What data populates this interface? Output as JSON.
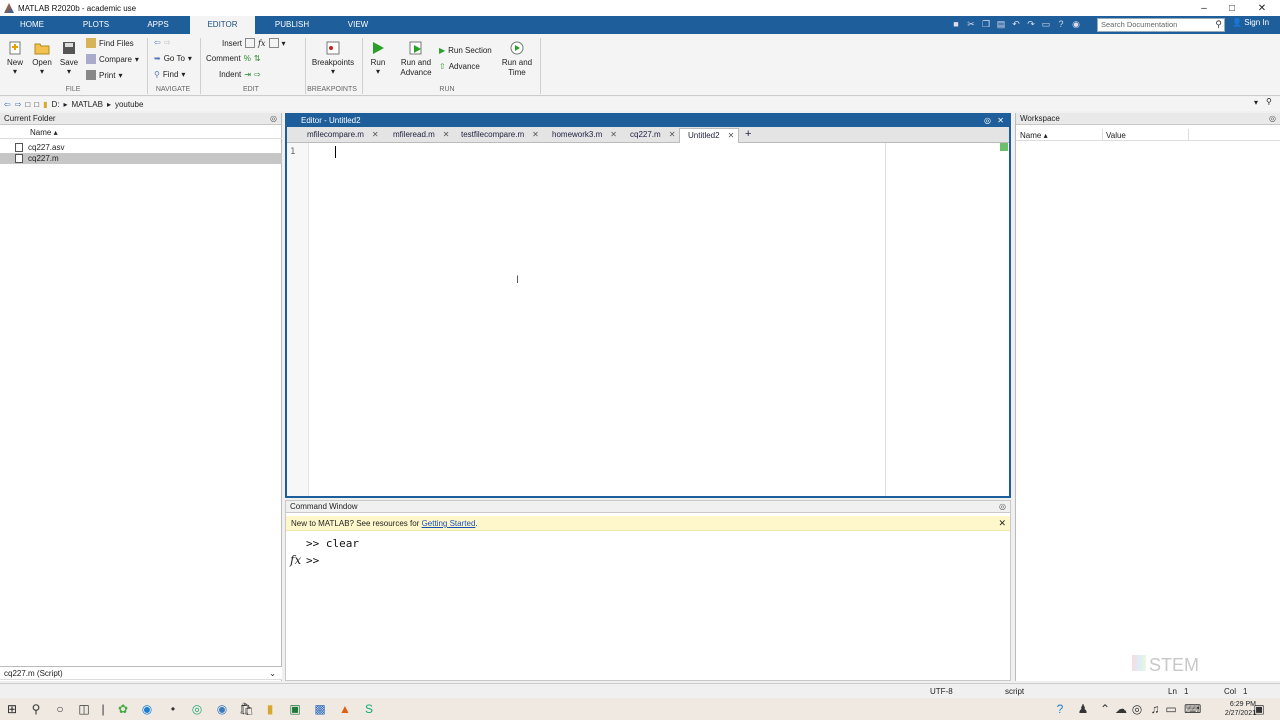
{
  "window": {
    "title": "MATLAB R2020b - academic use"
  },
  "ribbon_tabs": [
    "HOME",
    "PLOTS",
    "APPS",
    "EDITOR",
    "PUBLISH",
    "VIEW"
  ],
  "search": {
    "placeholder": "Search Documentation"
  },
  "signin": "Sign In",
  "toolbar": {
    "new": "New",
    "open": "Open",
    "save": "Save",
    "find_files": "Find Files",
    "compare": "Compare",
    "print": "Print",
    "go_to": "Go To",
    "find": "Find",
    "insert": "Insert",
    "comment": "Comment",
    "indent": "Indent",
    "breakpoints": "Breakpoints",
    "run": "Run",
    "run_and_advance_1": "Run and",
    "run_and_advance_2": "Advance",
    "run_section": "Run Section",
    "advance": "Advance",
    "run_and_time_1": "Run and",
    "run_and_time_2": "Time",
    "groups": {
      "file": "FILE",
      "navigate": "NAVIGATE",
      "edit": "EDIT",
      "breakpoints": "BREAKPOINTS",
      "run": "RUN"
    }
  },
  "address": {
    "drive": "D:",
    "folder1": "MATLAB",
    "folder2": "youtube"
  },
  "current_folder": {
    "title": "Current Folder",
    "col_name": "Name ▴",
    "files": [
      {
        "name": "cq227.asv"
      },
      {
        "name": "cq227.m"
      }
    ],
    "details": "cq227.m  (Script)"
  },
  "editor": {
    "title": "Editor - Untitled2",
    "tabs": [
      "mfilecompare.m",
      "mfileread.m",
      "testfilecompare.m",
      "homework3.m",
      "cq227.m",
      "Untitled2"
    ],
    "line_number": "1"
  },
  "command_window": {
    "title": "Command Window",
    "notice_prefix": "New to MATLAB? See resources for ",
    "notice_link": "Getting Started",
    "notice_suffix": ".",
    "history_line": ">> clear",
    "prompt": ">>"
  },
  "workspace": {
    "title": "Workspace",
    "col_name": "Name ▴",
    "col_value": "Value"
  },
  "status": {
    "encoding": "UTF-8",
    "type": "script",
    "ln_label": "Ln",
    "ln": "1",
    "col_label": "Col",
    "col": "1"
  },
  "clock": {
    "time": "6:29 PM",
    "date": "2/27/2021"
  },
  "watermark": "STEM",
  "colors": {
    "accent": "#1e5e9a",
    "notice_bg": "#fff7cc"
  }
}
